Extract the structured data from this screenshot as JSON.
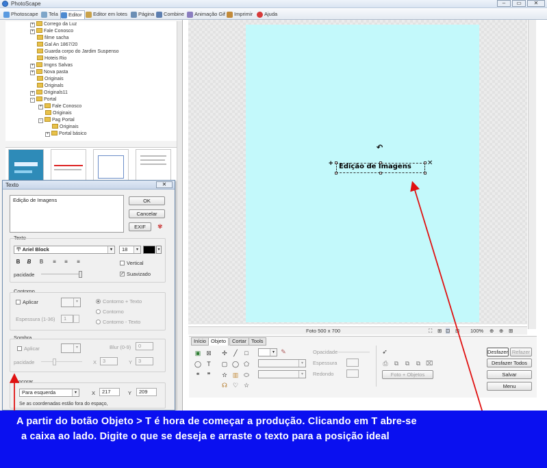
{
  "app": {
    "title": "PhotoScape",
    "window_buttons": [
      "–",
      "▭",
      "✕"
    ]
  },
  "tabs": [
    {
      "label": "Photoscape"
    },
    {
      "label": "Tela"
    },
    {
      "label": "Editor"
    },
    {
      "label": "Editor em lotes"
    },
    {
      "label": "Página"
    },
    {
      "label": "Combine"
    },
    {
      "label": "Animação Gif"
    },
    {
      "label": "Imprimir"
    },
    {
      "label": "Ajuda"
    }
  ],
  "folder_tree": [
    {
      "label": "Corrego da Luz",
      "exp": "+"
    },
    {
      "label": "Fale Conosco",
      "exp": "+"
    },
    {
      "label": "filme sacha",
      "exp": ""
    },
    {
      "label": "Gal An 1867/20",
      "exp": ""
    },
    {
      "label": "Guarda corpo do Jardim Suspenso",
      "exp": ""
    },
    {
      "label": "Hoteis Rio",
      "exp": ""
    },
    {
      "label": "Imgns Salvas",
      "exp": "+"
    },
    {
      "label": "Nova pasta",
      "exp": "+"
    },
    {
      "label": "Originais",
      "exp": ""
    },
    {
      "label": "Originals",
      "exp": ""
    },
    {
      "label": "Originals11",
      "exp": "+"
    },
    {
      "label": "Portal",
      "exp": "-"
    },
    {
      "label": "Fale Conosco",
      "exp": "+"
    },
    {
      "label": "Originais",
      "exp": ""
    },
    {
      "label": "Pag Portal",
      "exp": "-"
    },
    {
      "label": "Originais",
      "exp": ""
    },
    {
      "label": "Portal básico",
      "exp": "+"
    }
  ],
  "texto_dialog": {
    "title": "Texto",
    "close": "✕",
    "text_value": "Edição de Imagens",
    "ok": "OK",
    "cancel": "Cancelar",
    "exif": "EXIF",
    "section_texto": "Texto",
    "font": "Ariel Block",
    "font_size": "18",
    "vertical": "Vertical",
    "suavizado": "Suavizado",
    "opacidade": "pacidade",
    "section_contorno": "Contorno",
    "aplicar": "Aplicar",
    "contorno_texto": "Contorno + Texto",
    "contorno": "Contorno",
    "contorno_texto2": "Contorno - Texto",
    "espessura": "Espessura (1-36)",
    "espessura_val": "1",
    "section_sombra": "Sombra",
    "aplicar2": "Aplicar",
    "blur": "Blur (0-9)",
    "blur_val": "0",
    "opacidade2": "pacidade",
    "x_label": "X",
    "x_val": "3",
    "y_label": "Y",
    "y_val": "3",
    "section_ancorar": "Ancorar",
    "ancorar_value": "Para esquerda",
    "ax_label": "X",
    "ax_val": "217",
    "ay_label": "Y",
    "ay_val": "209",
    "warning": "Se as coordenadas estão fora do espaço,"
  },
  "canvas": {
    "text": "Edição de Imagens",
    "status_size": "Foto 500 x 700",
    "zoom": "100%"
  },
  "tool_tabs": [
    "Início",
    "Objeto",
    "Cortar",
    "Tools"
  ],
  "tool_panel": {
    "opacidade": "Opacidade",
    "espessura": "Espessura",
    "redondo": "Redondo",
    "foto_objetos": "Foto + Objetos",
    "desfazer": "Desfazer",
    "refazer": "Refazer",
    "desfazer_todos": "Desfazer Todos",
    "salvar": "Salvar",
    "menu": "Menu"
  },
  "instruction": {
    "line1": "A partir do botão Objeto > T é hora de começar a produção. Clicando em T abre-se",
    "line2": "a caixa ao lado. Digite o que se deseja e arraste o texto  para a posição ideal"
  },
  "colors": {
    "paper": "#c3f9fb",
    "band": "#0a10f0",
    "arrow": "#e01010"
  }
}
